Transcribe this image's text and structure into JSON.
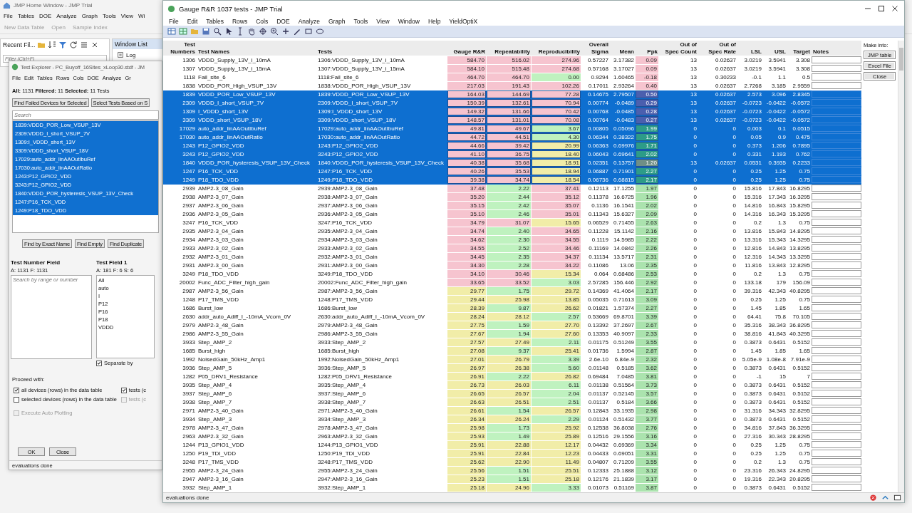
{
  "home_window": {
    "title": "JMP Home Window - JMP Trial",
    "menu": [
      "File",
      "Tables",
      "DOE",
      "Analyze",
      "Graph",
      "Tools",
      "View",
      "Wi"
    ],
    "toolbar": [
      "New Data Table",
      "Open",
      "Sample Index"
    ],
    "recent_files": {
      "title": "Recent Fil...",
      "filter_placeholder": "Filter (Ctrl+F)"
    },
    "window_list": {
      "title": "Window List",
      "items": [
        "Log"
      ]
    }
  },
  "test_explorer": {
    "title": "Test Explorer - PC_Buyoff_16Sites_xLoop30.stdf - JM",
    "menu": [
      "File",
      "Edit",
      "Tables",
      "Rows",
      "Cols",
      "DOE",
      "Analyze",
      "Gr"
    ],
    "summary": "**All:** 1131 **Filtered:** 11 **Selected:** 11 Tests",
    "top_buttons": [
      "Find Failed Devices for Selected",
      "Select Tests Based on S"
    ],
    "search_placeholder": "Search",
    "tests": [
      {
        "label": "1839:VDDD_POR_Low_VSUP_13V",
        "selected": true
      },
      {
        "label": "2309:VDDD_I_short_VSUP_7V",
        "selected": true
      },
      {
        "label": "1309:I_VDDD_short_13V",
        "selected": true
      },
      {
        "label": "3309:VDDD_short_VSUP_18V",
        "selected": true
      },
      {
        "label": "17029:auto_addr_linAAOutIbuRef",
        "selected": true
      },
      {
        "label": "17030:auto_addr_linAAOutRatio",
        "selected": true
      },
      {
        "label": "1243:P12_GPIO2_VDD",
        "selected": true
      },
      {
        "label": "3243:P12_GPIO2_VDD",
        "selected": true
      },
      {
        "label": "1840:VDDD_POR_hysteresis_VSUP_13V_Check",
        "selected": true
      },
      {
        "label": "1247:P16_TCK_VDD",
        "selected": true
      },
      {
        "label": "1249:P18_TDO_VDD",
        "selected": true
      }
    ],
    "find_buttons": [
      "Find by Exact Name",
      "Find Empty",
      "Find Duplicate"
    ],
    "test_number_field": {
      "title": "Test Number Field",
      "counts": "A: 1131 F: 1131",
      "placeholder": "Search by range or number"
    },
    "test_field": {
      "title": "Test Field 1",
      "counts": "A: 181 F: 6 S: 6",
      "items": [
        {
          "label": "All",
          "selected": false
        },
        {
          "label": "auto",
          "selected": false
        },
        {
          "label": "I",
          "selected": false
        },
        {
          "label": "P12",
          "selected": false
        },
        {
          "label": "P16",
          "selected": false
        },
        {
          "label": "P18",
          "selected": false
        },
        {
          "label": "VDDD",
          "selected": false
        }
      ],
      "separate_by": {
        "label": "Separate by",
        "checked": true
      }
    },
    "proceed_label": "Proceed with:",
    "proceed_options": [
      {
        "label": "all devices (rows) in the data table",
        "checked": true,
        "disabled": false
      },
      {
        "label": "tests (c",
        "checked": true,
        "disabled": false
      },
      {
        "label": "selected devices (rows) in the data table",
        "checked": false,
        "disabled": false
      },
      {
        "label": "tests (c",
        "checked": false,
        "disabled": true
      }
    ],
    "auto_plotting": {
      "label": "Execute Auto Plotting",
      "checked": false,
      "disabled": true
    },
    "buttons": [
      "OK",
      "Close"
    ],
    "status": "evaluations done"
  },
  "window": {
    "title": "Gauge R&R 1037 tests - JMP Trial",
    "menu": [
      "File",
      "Edit",
      "Tables",
      "Rows",
      "Cols",
      "DOE",
      "Analyze",
      "Graph",
      "Tools",
      "View",
      "Window",
      "Help",
      "YieldOptiX"
    ]
  },
  "table": {
    "columns": [
      "Test\nNumbers",
      "Test Names",
      "Tests",
      "Gauge R&R",
      "Repeatability",
      "Reproducibility",
      "Overall\nSigma",
      "Mean",
      "Ppk",
      "Out of\nSpec Count",
      "Out of\nSpec Rate",
      "LSL",
      "USL",
      "Target",
      "Notes"
    ],
    "rows": [
      {
        "selected": false,
        "cells": [
          "1306",
          "VDDD_Supply_13V_i_10mA",
          "1306:VDDD_Supply_13V_i_10mA",
          {
            "text": "584.70",
            "color": "#f6c4cf"
          },
          {
            "text": "516.02",
            "color": "#f6c4cf"
          },
          {
            "text": "274.96",
            "color": "#f6c4cf"
          },
          "0.57227",
          "3.17382",
          {
            "text": "0.09",
            "color": "#f6c4cf"
          },
          "13",
          "0.02637",
          "3.0219",
          "3.5941",
          "3.308"
        ]
      },
      {
        "selected": false,
        "cells": [
          "1307",
          "VDDD_Supply_13V_i_15mA",
          "1307:VDDD_Supply_13V_i_15mA",
          {
            "text": "584.10",
            "color": "#f6c4cf"
          },
          {
            "text": "515.48",
            "color": "#f6c4cf"
          },
          {
            "text": "274.68",
            "color": "#f6c4cf"
          },
          "0.57168",
          "3.17027",
          {
            "text": "0.09",
            "color": "#f6c4cf"
          },
          "13",
          "0.02637",
          "3.0219",
          "3.5941",
          "3.308"
        ]
      },
      {
        "selected": false,
        "cells": [
          "1118",
          "Fail_site_6",
          "1118:Fail_site_6",
          {
            "text": "464.70",
            "color": "#f6c4cf"
          },
          {
            "text": "464.70",
            "color": "#f6c4cf"
          },
          {
            "text": "0.00",
            "color": "#bff2bf"
          },
          "0.9294",
          "1.60465",
          {
            "text": "-0.18",
            "color": "#f6c4cf"
          },
          "13",
          "0.30233",
          "-0.1",
          "1.1",
          "0.5"
        ]
      },
      {
        "selected": false,
        "cells": [
          "1838",
          "VDDD_POR_High_VSUP_13V",
          "1838:VDDD_POR_High_VSUP_13V",
          {
            "text": "217.03",
            "color": "#f6c4cf"
          },
          {
            "text": "191.43",
            "color": "#f6c4cf"
          },
          {
            "text": "102.26",
            "color": "#f6c4cf"
          },
          "0.17011",
          "2.93264",
          {
            "text": "0.40",
            "color": "#f6c4cf"
          },
          "13",
          "0.02637",
          "2.7268",
          "3.185",
          "2.9559"
        ]
      },
      {
        "selected": true,
        "cells": [
          "1839",
          "VDDD_POR_Low_VSUP_13V",
          "1839:VDDD_POR_Low_VSUP_13V",
          {
            "text": "164.03",
            "color": "#f6c4cf"
          },
          {
            "text": "144.69",
            "color": "#f6c4cf"
          },
          {
            "text": "77.28",
            "color": "#f6c4cf"
          },
          "0.14675",
          "2.79507",
          {
            "text": "0.50",
            "color": "#4b5fae"
          },
          "13",
          "0.02637",
          "2.573",
          "3.096",
          "2.8345"
        ]
      },
      {
        "selected": true,
        "cells": [
          "2309",
          "VDDD_I_short_VSUP_7V",
          "2309:VDDD_I_short_VSUP_7V",
          {
            "text": "150.39",
            "color": "#f6c4cf"
          },
          {
            "text": "132.61",
            "color": "#f6c4cf"
          },
          {
            "text": "70.94",
            "color": "#f6c4cf"
          },
          "0.00774",
          "-0.0489",
          {
            "text": "0.29",
            "color": "#4b5fae"
          },
          "13",
          "0.02637",
          "-0.0723",
          "-0.0422",
          "-0.0572"
        ]
      },
      {
        "selected": true,
        "cells": [
          "1309",
          "I_VDDD_short_13V",
          "1309:I_VDDD_short_13V",
          {
            "text": "149.32",
            "color": "#f6c4cf"
          },
          {
            "text": "131.66",
            "color": "#f6c4cf"
          },
          {
            "text": "70.42",
            "color": "#f6c4cf"
          },
          "0.00768",
          "-0.0485",
          {
            "text": "0.28",
            "color": "#4b5fae"
          },
          "13",
          "0.02637",
          "-0.0723",
          "-0.0422",
          "-0.0572"
        ]
      },
      {
        "selected": true,
        "cells": [
          "3309",
          "VDDD_short_VSUP_18V",
          "3309:VDDD_short_VSUP_18V",
          {
            "text": "148.57",
            "color": "#f6c4cf"
          },
          {
            "text": "131.01",
            "color": "#f6c4cf"
          },
          {
            "text": "70.08",
            "color": "#f6c4cf"
          },
          "0.00764",
          "-0.0483",
          {
            "text": "0.27",
            "color": "#4b5fae"
          },
          "13",
          "0.02637",
          "-0.0723",
          "-0.0422",
          "-0.0572"
        ]
      },
      {
        "selected": true,
        "cells": [
          "17029",
          "auto_addr_linAAOutIbuRef",
          "17029:auto_addr_linAAOutIbuRef",
          {
            "text": "49.81",
            "color": "#f6c4cf"
          },
          {
            "text": "49.67",
            "color": "#f6c4cf"
          },
          {
            "text": "3.67",
            "color": "#bff2bf"
          },
          "0.00805",
          "0.05096",
          {
            "text": "1.99",
            "color": "#2d9c88"
          },
          "0",
          "0",
          "0.003",
          "0.1",
          "0.0515"
        ]
      },
      {
        "selected": true,
        "cells": [
          "17030",
          "auto_addr_linAAOutRatio",
          "17030:auto_addr_linAAOutRatio",
          {
            "text": "44.72",
            "color": "#f6c4cf"
          },
          {
            "text": "44.51",
            "color": "#f6c4cf"
          },
          {
            "text": "4.30",
            "color": "#bff2bf"
          },
          "0.06344",
          "0.38322",
          {
            "text": "1.75",
            "color": "#2d9c88"
          },
          "0",
          "0",
          "0.05",
          "0.9",
          "0.475"
        ]
      },
      {
        "selected": true,
        "cells": [
          "1243",
          "P12_GPIO2_VDD",
          "1243:P12_GPIO2_VDD",
          {
            "text": "44.66",
            "color": "#f6c4cf"
          },
          {
            "text": "39.42",
            "color": "#f6c4cf"
          },
          {
            "text": "20.99",
            "color": "#f1eda8"
          },
          "0.06363",
          "0.69976",
          {
            "text": "1.71",
            "color": "#2d9c88"
          },
          "0",
          "0",
          "0.373",
          "1.206",
          "0.7895"
        ]
      },
      {
        "selected": true,
        "cells": [
          "3243",
          "P12_GPIO2_VDD",
          "3243:P12_GPIO2_VDD",
          {
            "text": "41.10",
            "color": "#f6c4cf"
          },
          {
            "text": "36.75",
            "color": "#f6c4cf"
          },
          {
            "text": "18.40",
            "color": "#f1eda8"
          },
          "0.06043",
          "0.69641",
          {
            "text": "2.02",
            "color": "#2d9c88"
          },
          "0",
          "0",
          "0.331",
          "1.193",
          "0.762"
        ]
      },
      {
        "selected": true,
        "cells": [
          "1840",
          "VDDD_POR_hysteresis_VSUP_13V_Check",
          "1840:VDDD_POR_hysteresis_VSUP_13V_Check",
          {
            "text": "40.38",
            "color": "#f6c4cf"
          },
          {
            "text": "35.68",
            "color": "#f6c4cf"
          },
          {
            "text": "18.91",
            "color": "#f1eda8"
          },
          "0.02351",
          "0.13757",
          {
            "text": "1.20",
            "color": "#6f8f86"
          },
          "13",
          "0.02637",
          "0.0531",
          "0.3935",
          "0.2233"
        ]
      },
      {
        "selected": true,
        "cells": [
          "1247",
          "P16_TCK_VDD",
          "1247:P16_TCK_VDD",
          {
            "text": "40.26",
            "color": "#f6c4cf"
          },
          {
            "text": "35.53",
            "color": "#f6c4cf"
          },
          {
            "text": "18.94",
            "color": "#f1eda8"
          },
          "0.06887",
          "0.71901",
          {
            "text": "2.27",
            "color": "#2d9c88"
          },
          "0",
          "0",
          "0.25",
          "1.25",
          "0.75"
        ]
      },
      {
        "selected": true,
        "cells": [
          "1249",
          "P18_TDO_VDD",
          "1249:P18_TDO_VDD",
          {
            "text": "39.38",
            "color": "#f6c4cf"
          },
          {
            "text": "34.74",
            "color": "#f6c4cf"
          },
          {
            "text": "18.54",
            "color": "#f1eda8"
          },
          "0.06736",
          "0.68815",
          {
            "text": "2.17",
            "color": "#2d9c88"
          },
          "0",
          "0",
          "0.25",
          "1.25",
          "0.75"
        ]
      },
      {
        "selected": false,
        "cells": [
          "2939",
          "AMP2-3_08_Gain",
          "2939:AMP2-3_08_Gain",
          {
            "text": "37.48",
            "color": "#f6c4cf"
          },
          {
            "text": "2.22",
            "color": "#bff2bf"
          },
          {
            "text": "37.41",
            "color": "#f6c4cf"
          },
          "0.12113",
          "17.1255",
          {
            "text": "1.97",
            "color": "#abe3ae"
          },
          "0",
          "0",
          "15.816",
          "17.843",
          "16.8295"
        ]
      },
      {
        "selected": false,
        "cells": [
          "2938",
          "AMP2-3_07_Gain",
          "2938:AMP2-3_07_Gain",
          {
            "text": "35.20",
            "color": "#f6c4cf"
          },
          {
            "text": "2.44",
            "color": "#bff2bf"
          },
          {
            "text": "35.12",
            "color": "#f6c4cf"
          },
          "0.11378",
          "16.6725",
          {
            "text": "1.96",
            "color": "#abe3ae"
          },
          "0",
          "0",
          "15.316",
          "17.343",
          "16.3295"
        ]
      },
      {
        "selected": false,
        "cells": [
          "2937",
          "AMP2-3_06_Gain",
          "2937:AMP2-3_06_Gain",
          {
            "text": "35.15",
            "color": "#f6c4cf"
          },
          {
            "text": "2.42",
            "color": "#bff2bf"
          },
          {
            "text": "35.07",
            "color": "#f6c4cf"
          },
          "0.1136",
          "16.1541",
          {
            "text": "2.02",
            "color": "#abe3ae"
          },
          "0",
          "0",
          "14.816",
          "16.843",
          "15.8295"
        ]
      },
      {
        "selected": false,
        "cells": [
          "2936",
          "AMP2-3_05_Gain",
          "2936:AMP2-3_05_Gain",
          {
            "text": "35.10",
            "color": "#f6c4cf"
          },
          {
            "text": "2.46",
            "color": "#bff2bf"
          },
          {
            "text": "35.01",
            "color": "#f6c4cf"
          },
          "0.11343",
          "15.6327",
          {
            "text": "2.09",
            "color": "#abe3ae"
          },
          "0",
          "0",
          "14.316",
          "16.343",
          "15.3295"
        ]
      },
      {
        "selected": false,
        "cells": [
          "3247",
          "P16_TCK_VDD",
          "3247:P16_TCK_VDD",
          {
            "text": "34.79",
            "color": "#f6c4cf"
          },
          {
            "text": "31.07",
            "color": "#f6c4cf"
          },
          {
            "text": "15.65",
            "color": "#f1eda8"
          },
          "0.06529",
          "0.71455",
          {
            "text": "2.63",
            "color": "#abe3ae"
          },
          "0",
          "0",
          "0.2",
          "1.3",
          "0.75"
        ]
      },
      {
        "selected": false,
        "cells": [
          "2935",
          "AMP2-3_04_Gain",
          "2935:AMP2-3_04_Gain",
          {
            "text": "34.74",
            "color": "#f6c4cf"
          },
          {
            "text": "2.40",
            "color": "#bff2bf"
          },
          {
            "text": "34.65",
            "color": "#f6c4cf"
          },
          "0.11228",
          "15.1142",
          {
            "text": "2.16",
            "color": "#abe3ae"
          },
          "0",
          "0",
          "13.816",
          "15.843",
          "14.8295"
        ]
      },
      {
        "selected": false,
        "cells": [
          "2934",
          "AMP2-3_03_Gain",
          "2934:AMP2-3_03_Gain",
          {
            "text": "34.62",
            "color": "#f6c4cf"
          },
          {
            "text": "2.30",
            "color": "#bff2bf"
          },
          {
            "text": "34.55",
            "color": "#f6c4cf"
          },
          "0.1119",
          "14.5985",
          {
            "text": "2.22",
            "color": "#abe3ae"
          },
          "0",
          "0",
          "13.316",
          "15.343",
          "14.3295"
        ]
      },
      {
        "selected": false,
        "cells": [
          "2933",
          "AMP2-3_02_Gain",
          "2933:AMP2-3_02_Gain",
          {
            "text": "34.55",
            "color": "#f6c4cf"
          },
          {
            "text": "2.52",
            "color": "#bff2bf"
          },
          {
            "text": "34.46",
            "color": "#f6c4cf"
          },
          "0.11169",
          "14.0842",
          {
            "text": "2.26",
            "color": "#abe3ae"
          },
          "0",
          "0",
          "12.816",
          "14.843",
          "13.8295"
        ]
      },
      {
        "selected": false,
        "cells": [
          "2932",
          "AMP2-3_01_Gain",
          "2932:AMP2-3_01_Gain",
          {
            "text": "34.45",
            "color": "#f6c4cf"
          },
          {
            "text": "2.35",
            "color": "#bff2bf"
          },
          {
            "text": "34.37",
            "color": "#f6c4cf"
          },
          "0.11134",
          "13.5717",
          {
            "text": "2.31",
            "color": "#abe3ae"
          },
          "0",
          "0",
          "12.316",
          "14.343",
          "13.3295"
        ]
      },
      {
        "selected": false,
        "cells": [
          "2931",
          "AMP2-3_00_Gain",
          "2931:AMP2-3_00_Gain",
          {
            "text": "34.30",
            "color": "#f6c4cf"
          },
          {
            "text": "2.28",
            "color": "#bff2bf"
          },
          {
            "text": "34.22",
            "color": "#f6c4cf"
          },
          "0.11086",
          "13.06",
          {
            "text": "2.35",
            "color": "#abe3ae"
          },
          "0",
          "0",
          "11.816",
          "13.843",
          "12.8295"
        ]
      },
      {
        "selected": false,
        "cells": [
          "3249",
          "P18_TDO_VDD",
          "3249:P18_TDO_VDD",
          {
            "text": "34.10",
            "color": "#f6c4cf"
          },
          {
            "text": "30.46",
            "color": "#f6c4cf"
          },
          {
            "text": "15.34",
            "color": "#f1eda8"
          },
          "0.064",
          "0.68486",
          {
            "text": "2.53",
            "color": "#abe3ae"
          },
          "0",
          "0",
          "0.2",
          "1.3",
          "0.75"
        ]
      },
      {
        "selected": false,
        "cells": [
          "20002",
          "Func_ADC_Filter_high_gain",
          "20002:Func_ADC_Filter_high_gain",
          {
            "text": "33.65",
            "color": "#f6c4cf"
          },
          {
            "text": "33.52",
            "color": "#f6c4cf"
          },
          {
            "text": "3.03",
            "color": "#bff2bf"
          },
          "2.57285",
          "156.446",
          {
            "text": "2.92",
            "color": "#abe3ae"
          },
          "0",
          "0",
          "133.18",
          "179",
          "156.09"
        ]
      },
      {
        "selected": false,
        "cells": [
          "2987",
          "AMP2-3_56_Gain",
          "2987:AMP2-3_56_Gain",
          {
            "text": "29.77",
            "color": "#f1eda8"
          },
          {
            "text": "1.75",
            "color": "#bff2bf"
          },
          {
            "text": "29.72",
            "color": "#f1eda8"
          },
          "0.14369",
          "41.4064",
          {
            "text": "2.17",
            "color": "#abe3ae"
          },
          "0",
          "0",
          "39.316",
          "42.343",
          "40.8295"
        ]
      },
      {
        "selected": false,
        "cells": [
          "1248",
          "P17_TMS_VDD",
          "1248:P17_TMS_VDD",
          {
            "text": "29.44",
            "color": "#f1eda8"
          },
          {
            "text": "25.98",
            "color": "#f1eda8"
          },
          {
            "text": "13.85",
            "color": "#f1eda8"
          },
          "0.05035",
          "0.71613",
          {
            "text": "3.09",
            "color": "#abe3ae"
          },
          "0",
          "0",
          "0.25",
          "1.25",
          "0.75"
        ]
      },
      {
        "selected": false,
        "cells": [
          "1686",
          "Burst_low",
          "1686:Burst_low",
          {
            "text": "28.39",
            "color": "#f1eda8"
          },
          {
            "text": "9.87",
            "color": "#bff2bf"
          },
          {
            "text": "26.62",
            "color": "#f1eda8"
          },
          "0.01821",
          "1.57374",
          {
            "text": "2.27",
            "color": "#abe3ae"
          },
          "0",
          "0",
          "1.45",
          "1.85",
          "1.65"
        ]
      },
      {
        "selected": false,
        "cells": [
          "2630",
          "addr_auto_Adiff_I_-10mA_Vcom_0V",
          "2630:addr_auto_Adiff_I_-10mA_Vcom_0V",
          {
            "text": "28.24",
            "color": "#f1eda8"
          },
          {
            "text": "28.12",
            "color": "#f1eda8"
          },
          {
            "text": "2.57",
            "color": "#bff2bf"
          },
          "0.53669",
          "69.8701",
          {
            "text": "3.39",
            "color": "#abe3ae"
          },
          "0",
          "0",
          "64.41",
          "75.8",
          "70.105"
        ]
      },
      {
        "selected": false,
        "cells": [
          "2979",
          "AMP2-3_48_Gain",
          "2979:AMP2-3_48_Gain",
          {
            "text": "27.75",
            "color": "#f1eda8"
          },
          {
            "text": "1.59",
            "color": "#bff2bf"
          },
          {
            "text": "27.70",
            "color": "#f1eda8"
          },
          "0.13392",
          "37.2697",
          {
            "text": "2.67",
            "color": "#abe3ae"
          },
          "0",
          "0",
          "35.316",
          "38.343",
          "36.8295"
        ]
      },
      {
        "selected": false,
        "cells": [
          "2986",
          "AMP2-3_55_Gain",
          "2986:AMP2-3_55_Gain",
          {
            "text": "27.67",
            "color": "#f1eda8"
          },
          {
            "text": "1.94",
            "color": "#bff2bf"
          },
          {
            "text": "27.60",
            "color": "#f1eda8"
          },
          "0.13353",
          "40.9097",
          {
            "text": "2.33",
            "color": "#abe3ae"
          },
          "0",
          "0",
          "38.816",
          "41.843",
          "40.3295"
        ]
      },
      {
        "selected": false,
        "cells": [
          "3933",
          "Step_AMP_2",
          "3933:Step_AMP_2",
          {
            "text": "27.57",
            "color": "#f1eda8"
          },
          {
            "text": "27.49",
            "color": "#f1eda8"
          },
          {
            "text": "2.11",
            "color": "#bff2bf"
          },
          "0.01175",
          "0.51249",
          {
            "text": "3.55",
            "color": "#abe3ae"
          },
          "0",
          "0",
          "0.3873",
          "0.6431",
          "0.5152"
        ]
      },
      {
        "selected": false,
        "cells": [
          "1685",
          "Burst_high",
          "1685:Burst_high",
          {
            "text": "27.08",
            "color": "#f1eda8"
          },
          {
            "text": "9.37",
            "color": "#bff2bf"
          },
          {
            "text": "25.41",
            "color": "#f1eda8"
          },
          "0.01736",
          "1.5994",
          {
            "text": "2.87",
            "color": "#abe3ae"
          },
          "0",
          "0",
          "1.45",
          "1.85",
          "1.65"
        ]
      },
      {
        "selected": false,
        "cells": [
          "1992",
          "NoisedGain_50kHz_Amp1",
          "1992:NoisedGain_50kHz_Amp1",
          {
            "text": "27.01",
            "color": "#f1eda8"
          },
          {
            "text": "26.79",
            "color": "#f1eda8"
          },
          {
            "text": "3.39",
            "color": "#bff2bf"
          },
          "2.6e-10",
          "6.84e-9",
          {
            "text": "2.32",
            "color": "#abe3ae"
          },
          "0",
          "0",
          "5.05e-9",
          "1.08e-8",
          "7.91e-9"
        ]
      },
      {
        "selected": false,
        "cells": [
          "3936",
          "Step_AMP_5",
          "3936:Step_AMP_5",
          {
            "text": "26.97",
            "color": "#f1eda8"
          },
          {
            "text": "26.38",
            "color": "#f1eda8"
          },
          {
            "text": "5.60",
            "color": "#bff2bf"
          },
          "0.01148",
          "0.5185",
          {
            "text": "3.62",
            "color": "#abe3ae"
          },
          "0",
          "0",
          "0.3873",
          "0.6431",
          "0.5152"
        ]
      },
      {
        "selected": false,
        "cells": [
          "1282",
          "P05_DRV1_Resistance",
          "1282:P05_DRV1_Resistance",
          {
            "text": "26.91",
            "color": "#f1eda8"
          },
          {
            "text": "2.22",
            "color": "#bff2bf"
          },
          {
            "text": "26.82",
            "color": "#f1eda8"
          },
          "0.69484",
          "7.0485",
          {
            "text": "3.81",
            "color": "#abe3ae"
          },
          "0",
          "0",
          "-1",
          "15",
          "7"
        ]
      },
      {
        "selected": false,
        "cells": [
          "3935",
          "Step_AMP_4",
          "3935:Step_AMP_4",
          {
            "text": "26.73",
            "color": "#f1eda8"
          },
          {
            "text": "26.03",
            "color": "#f1eda8"
          },
          {
            "text": "6.11",
            "color": "#bff2bf"
          },
          "0.01138",
          "0.51564",
          {
            "text": "3.73",
            "color": "#abe3ae"
          },
          "0",
          "0",
          "0.3873",
          "0.6431",
          "0.5152"
        ]
      },
      {
        "selected": false,
        "cells": [
          "3937",
          "Step_AMP_6",
          "3937:Step_AMP_6",
          {
            "text": "26.65",
            "color": "#f1eda8"
          },
          {
            "text": "26.57",
            "color": "#f1eda8"
          },
          {
            "text": "2.04",
            "color": "#bff2bf"
          },
          "0.01137",
          "0.52145",
          {
            "text": "3.57",
            "color": "#abe3ae"
          },
          "0",
          "0",
          "0.3873",
          "0.6431",
          "0.5152"
        ]
      },
      {
        "selected": false,
        "cells": [
          "3938",
          "Step_AMP_7",
          "3938:Step_AMP_7",
          {
            "text": "26.63",
            "color": "#f1eda8"
          },
          {
            "text": "26.51",
            "color": "#f1eda8"
          },
          {
            "text": "2.51",
            "color": "#bff2bf"
          },
          "0.01137",
          "0.5184",
          {
            "text": "3.66",
            "color": "#abe3ae"
          },
          "0",
          "0",
          "0.3873",
          "0.6431",
          "0.5152"
        ]
      },
      {
        "selected": false,
        "cells": [
          "2971",
          "AMP2-3_40_Gain",
          "2971:AMP2-3_40_Gain",
          {
            "text": "26.61",
            "color": "#f1eda8"
          },
          {
            "text": "1.54",
            "color": "#bff2bf"
          },
          {
            "text": "26.57",
            "color": "#f1eda8"
          },
          "0.12843",
          "33.1935",
          {
            "text": "2.98",
            "color": "#abe3ae"
          },
          "0",
          "0",
          "31.316",
          "34.343",
          "32.8295"
        ]
      },
      {
        "selected": false,
        "cells": [
          "3934",
          "Step_AMP_3",
          "3934:Step_AMP_3",
          {
            "text": "26.34",
            "color": "#f1eda8"
          },
          {
            "text": "26.24",
            "color": "#f1eda8"
          },
          {
            "text": "2.29",
            "color": "#bff2bf"
          },
          "0.01124",
          "0.51432",
          {
            "text": "3.77",
            "color": "#abe3ae"
          },
          "0",
          "0",
          "0.3873",
          "0.6431",
          "0.5152"
        ]
      },
      {
        "selected": false,
        "cells": [
          "2978",
          "AMP2-3_47_Gain",
          "2978:AMP2-3_47_Gain",
          {
            "text": "25.98",
            "color": "#f1eda8"
          },
          {
            "text": "1.73",
            "color": "#bff2bf"
          },
          {
            "text": "25.92",
            "color": "#f1eda8"
          },
          "0.12538",
          "36.8038",
          {
            "text": "2.76",
            "color": "#abe3ae"
          },
          "0",
          "0",
          "34.816",
          "37.843",
          "36.3295"
        ]
      },
      {
        "selected": false,
        "cells": [
          "2963",
          "AMP2-3_32_Gain",
          "2963:AMP2-3_32_Gain",
          {
            "text": "25.93",
            "color": "#f1eda8"
          },
          {
            "text": "1.49",
            "color": "#bff2bf"
          },
          {
            "text": "25.89",
            "color": "#f1eda8"
          },
          "0.12516",
          "29.1556",
          {
            "text": "3.16",
            "color": "#abe3ae"
          },
          "0",
          "0",
          "27.316",
          "30.343",
          "28.8295"
        ]
      },
      {
        "selected": false,
        "cells": [
          "1244",
          "P13_GPIO1_VDD",
          "1244:P13_GPIO1_VDD",
          {
            "text": "25.91",
            "color": "#f1eda8"
          },
          {
            "text": "22.88",
            "color": "#f1eda8"
          },
          {
            "text": "12.17",
            "color": "#f1eda8"
          },
          "0.04432",
          "0.69369",
          {
            "text": "3.34",
            "color": "#abe3ae"
          },
          "0",
          "0",
          "0.25",
          "1.25",
          "0.75"
        ]
      },
      {
        "selected": false,
        "cells": [
          "1250",
          "P19_TDI_VDD",
          "1250:P19_TDI_VDD",
          {
            "text": "25.91",
            "color": "#f1eda8"
          },
          {
            "text": "22.84",
            "color": "#f1eda8"
          },
          {
            "text": "12.23",
            "color": "#f1eda8"
          },
          "0.04433",
          "0.69051",
          {
            "text": "3.31",
            "color": "#abe3ae"
          },
          "0",
          "0",
          "0.25",
          "1.25",
          "0.75"
        ]
      },
      {
        "selected": false,
        "cells": [
          "3248",
          "P17_TMS_VDD",
          "3248:P17_TMS_VDD",
          {
            "text": "25.62",
            "color": "#f1eda8"
          },
          {
            "text": "22.90",
            "color": "#f1eda8"
          },
          {
            "text": "11.49",
            "color": "#f1eda8"
          },
          "0.04807",
          "0.71209",
          {
            "text": "3.55",
            "color": "#abe3ae"
          },
          "0",
          "0",
          "0.2",
          "1.3",
          "0.75"
        ]
      },
      {
        "selected": false,
        "cells": [
          "2955",
          "AMP2-3_24_Gain",
          "2955:AMP2-3_24_Gain",
          {
            "text": "25.56",
            "color": "#f1eda8"
          },
          {
            "text": "1.51",
            "color": "#bff2bf"
          },
          {
            "text": "25.51",
            "color": "#f1eda8"
          },
          "0.12333",
          "25.1888",
          {
            "text": "3.12",
            "color": "#abe3ae"
          },
          "0",
          "0",
          "23.316",
          "26.343",
          "24.8295"
        ]
      },
      {
        "selected": false,
        "cells": [
          "2947",
          "AMP2-3_16_Gain",
          "2947:AMP2-3_16_Gain",
          {
            "text": "25.23",
            "color": "#f1eda8"
          },
          {
            "text": "1.51",
            "color": "#bff2bf"
          },
          {
            "text": "25.18",
            "color": "#f1eda8"
          },
          "0.12176",
          "21.1839",
          {
            "text": "3.17",
            "color": "#abe3ae"
          },
          "0",
          "0",
          "19.316",
          "22.343",
          "20.8295"
        ]
      },
      {
        "selected": false,
        "cells": [
          "3932",
          "Step_AMP_1",
          "3932:Step_AMP_1",
          {
            "text": "25.18",
            "color": "#f1eda8"
          },
          {
            "text": "24.96",
            "color": "#f1eda8"
          },
          {
            "text": "3.33",
            "color": "#bff2bf"
          },
          "0.01073",
          "0.51169",
          {
            "text": "3.87",
            "color": "#abe3ae"
          },
          "0",
          "0",
          "0.3873",
          "0.6431",
          "0.5152"
        ]
      }
    ]
  },
  "export_panel": {
    "label": "Make into:",
    "buttons": [
      "JMP table",
      "Excel File",
      "Close"
    ]
  },
  "status_bar": "evaluations done"
}
